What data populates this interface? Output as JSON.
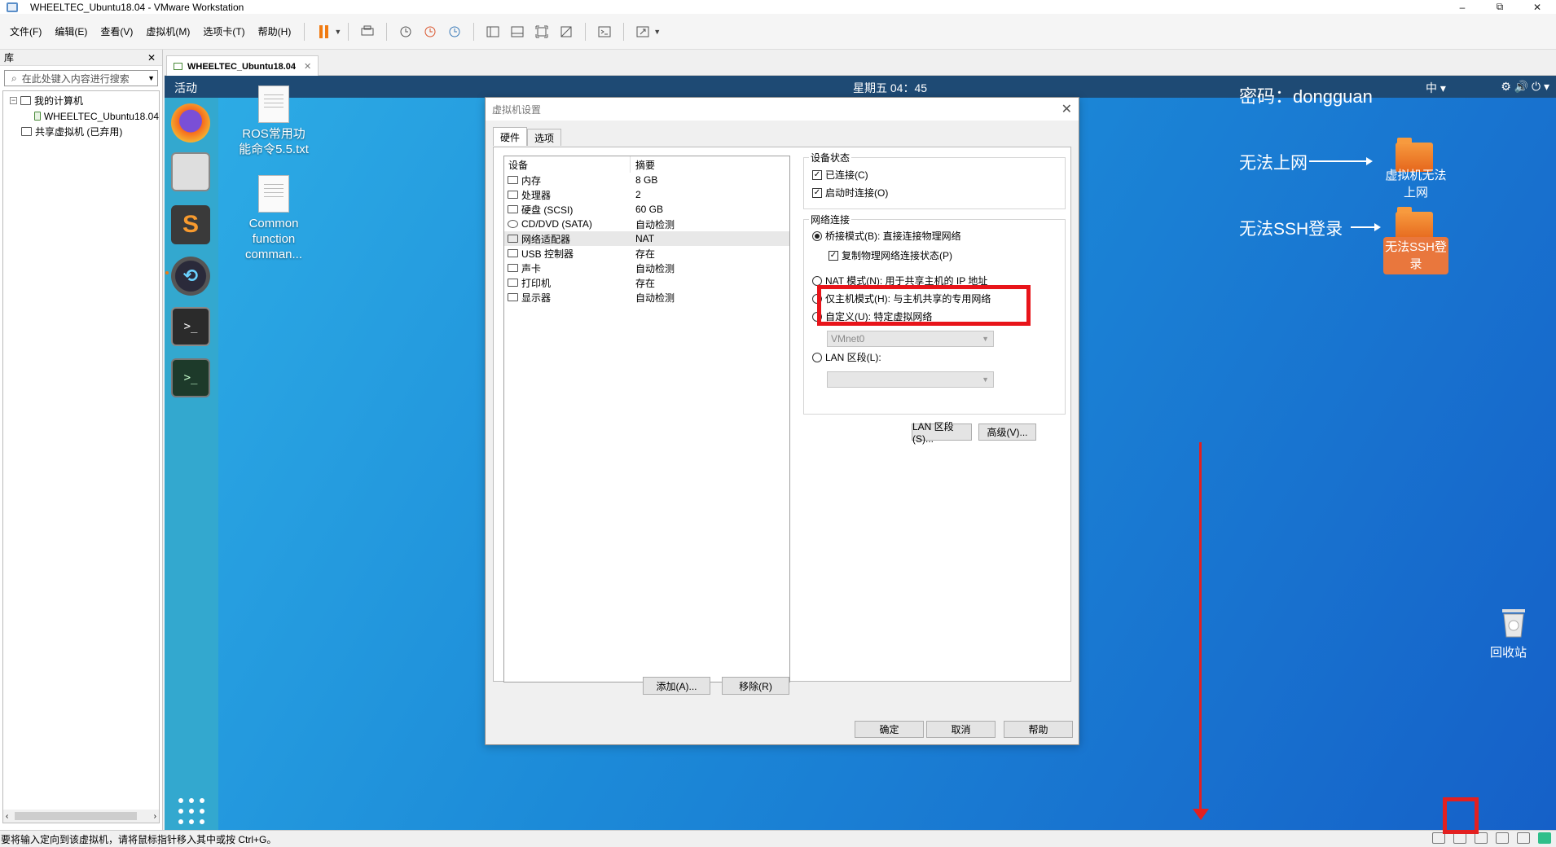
{
  "window": {
    "title": "WHEELTEC_Ubuntu18.04 - VMware Workstation",
    "minimize": "–",
    "restore": "⧉",
    "close": "✕"
  },
  "menu": [
    "文件(F)",
    "编辑(E)",
    "查看(V)",
    "虚拟机(M)",
    "选项卡(T)",
    "帮助(H)"
  ],
  "library": {
    "title": "库",
    "close": "✕",
    "search_placeholder": "在此处键入内容进行搜索",
    "tree": {
      "my_computer": "我的计算机",
      "vm": "WHEELTEC_Ubuntu18.04",
      "shared": "共享虚拟机 (已弃用)"
    }
  },
  "tab": {
    "label": "WHEELTEC_Ubuntu18.04",
    "close": "✕"
  },
  "gnome": {
    "activities": "活动",
    "clock": "星期五 04：45",
    "ime": "中 ▾",
    "sys_icons": "⚙ 🔊 ⏻ ▾"
  },
  "desktop": {
    "file1": "ROS常用功能命令5.5.txt",
    "file2": "Common function comman...",
    "password": "密码：dongguan",
    "no_internet": "无法上网",
    "no_ssh": "无法SSH登录",
    "folder1": "虚拟机无法上网",
    "folder2": "无法SSH登录",
    "trash": "回收站"
  },
  "dialog": {
    "title": "虚拟机设置",
    "close": "✕",
    "tabs": [
      "硬件",
      "选项"
    ],
    "device_header": "设备",
    "summary_header": "摘要",
    "devices": [
      {
        "name": "内存",
        "summary": "8 GB"
      },
      {
        "name": "处理器",
        "summary": "2"
      },
      {
        "name": "硬盘 (SCSI)",
        "summary": "60 GB"
      },
      {
        "name": "CD/DVD (SATA)",
        "summary": "自动检测"
      },
      {
        "name": "网络适配器",
        "summary": "NAT"
      },
      {
        "name": "USB 控制器",
        "summary": "存在"
      },
      {
        "name": "声卡",
        "summary": "自动检测"
      },
      {
        "name": "打印机",
        "summary": "存在"
      },
      {
        "name": "显示器",
        "summary": "自动检测"
      }
    ],
    "add": "添加(A)...",
    "remove": "移除(R)",
    "device_status": "设备状态",
    "connected": "已连接(C)",
    "connect_on_power": "启动时连接(O)",
    "network_connection": "网络连接",
    "bridged": "桥接模式(B): 直接连接物理网络",
    "replicate": "复制物理网络连接状态(P)",
    "nat": "NAT 模式(N): 用于共享主机的 IP 地址",
    "host_only": "仅主机模式(H): 与主机共享的专用网络",
    "custom": "自定义(U): 特定虚拟网络",
    "vmnet": "VMnet0",
    "lan_segment": "LAN 区段(L):",
    "lan_btn": "LAN 区段(S)...",
    "advanced_btn": "高级(V)...",
    "ok": "确定",
    "cancel": "取消",
    "help": "帮助"
  },
  "status": {
    "message": "要将输入定向到该虚拟机，请将鼠标指针移入其中或按 Ctrl+G。"
  },
  "colors": {
    "annotation_red": "#e32020",
    "accent_orange": "#f07b12"
  }
}
